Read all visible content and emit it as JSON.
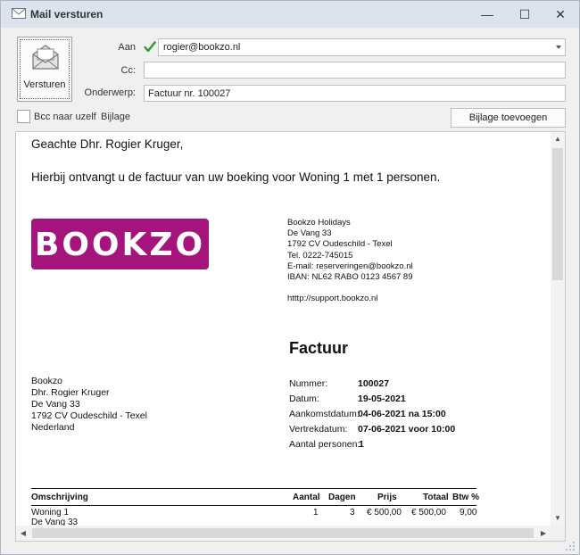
{
  "window": {
    "title": "Mail versturen",
    "minimize": "—",
    "maximize": "☐",
    "close": "✕"
  },
  "header": {
    "send_label": "Versturen",
    "to_label": "Aan",
    "to_value": "rogier@bookzo.nl",
    "cc_label": "Cc:",
    "cc_value": "",
    "subject_label": "Onderwerp:",
    "subject_value": "Factuur nr. 100027",
    "bcc_label": "Bcc naar uzelf",
    "attachment_label": "Bijlage",
    "add_attachment_label": "Bijlage toevoegen"
  },
  "message": {
    "greeting": "Geachte Dhr. Rogier Kruger,",
    "intro": "Hierbij ontvangt u de factuur van uw boeking voor Woning 1 met 1 personen.",
    "logo_text": "BOOKZO",
    "company_lines": [
      "Bookzo Holidays",
      "De Vang 33",
      "1792 CV  Oudeschild - Texel",
      "Tel. 0222-745015",
      "E-mail: reserveringen@bookzo.nl",
      "IBAN: NL62 RABO 0123 4567 89",
      "",
      "htttp://support.bookzo.nl"
    ],
    "invoice_title": "Factuur",
    "recipient_lines": [
      "Bookzo",
      "Dhr. Rogier Kruger",
      "De Vang 33",
      "1792 CV Oudeschild - Texel",
      "Nederland"
    ],
    "invoice_meta": [
      {
        "key": "Nummer:",
        "value": "100027"
      },
      {
        "key": "Datum:",
        "value": "19-05-2021"
      },
      {
        "key": "Aankomstdatum:",
        "value": "04-06-2021 na 15:00"
      },
      {
        "key": "Vertrekdatum:",
        "value": "07-06-2021 voor 10:00"
      },
      {
        "key": "Aantal personen:",
        "value": "1"
      }
    ],
    "table": {
      "headers": {
        "desc": "Omschrijving",
        "qty": "Aantal",
        "days": "Dagen",
        "price": "Prijs",
        "total": "Totaal",
        "vat": "Btw %"
      },
      "rows": [
        {
          "desc": "Woning 1",
          "desc2": "De Vang 33",
          "qty": "1",
          "days": "3",
          "price": "€ 500,00",
          "total": "€ 500,00",
          "vat": "9,00"
        }
      ]
    }
  },
  "colors": {
    "brand": "#a4147c",
    "titlebar": "#dde3ec",
    "check": "#2e9a2e"
  },
  "icons": [
    "mail-icon",
    "envelope-icon",
    "check-icon",
    "chevron-down-icon"
  ]
}
